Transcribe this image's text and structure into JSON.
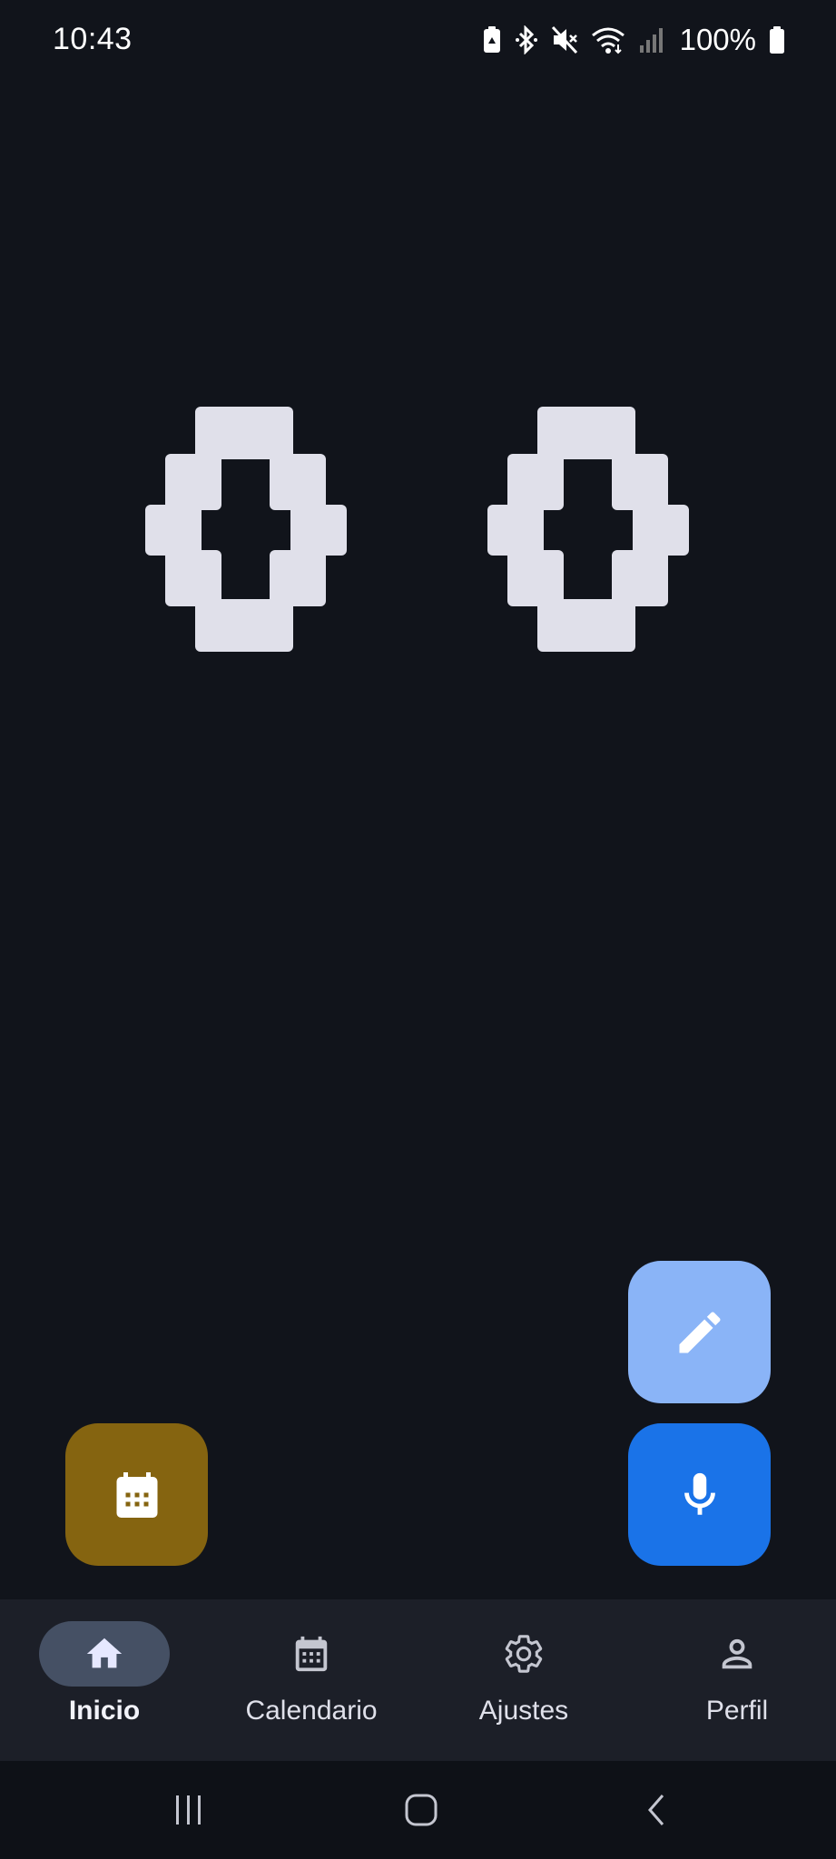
{
  "status_bar": {
    "time": "10:43",
    "battery_text": "100%",
    "icons": [
      "battery-saver-icon",
      "bluetooth-icon",
      "mute-icon",
      "wifi-icon",
      "signal-icon",
      "battery-icon"
    ]
  },
  "display": {
    "digits": [
      "0",
      "0"
    ],
    "color": "#e0e0ea"
  },
  "fabs": {
    "edit_icon": "pencil-icon",
    "mic_icon": "microphone-icon",
    "calendar_icon": "calendar-icon",
    "colors": {
      "edit": "#8ab4f7",
      "mic": "#1a73e8",
      "calendar": "#856410"
    }
  },
  "bottom_nav": {
    "items": [
      {
        "label": "Inicio",
        "icon": "home-icon",
        "active": true
      },
      {
        "label": "Calendario",
        "icon": "calendar-icon",
        "active": false
      },
      {
        "label": "Ajustes",
        "icon": "gear-icon",
        "active": false
      },
      {
        "label": "Perfil",
        "icon": "person-icon",
        "active": false
      }
    ]
  },
  "system_nav": {
    "buttons": [
      "recents-icon",
      "home-button-icon",
      "back-icon"
    ]
  }
}
